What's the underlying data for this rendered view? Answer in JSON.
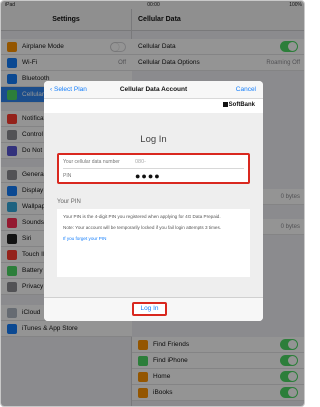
{
  "status_bar": {
    "carrier": "iPad",
    "time": "00:00",
    "battery": "100%"
  },
  "left_pane": {
    "title": "Settings",
    "items": [
      {
        "label": "Airplane Mode",
        "value": ""
      },
      {
        "label": "Wi-Fi",
        "value": "Off"
      },
      {
        "label": "Bluetooth",
        "value": ""
      },
      {
        "label": "Cellular Data",
        "value": ""
      },
      {
        "label": "Notifications",
        "value": ""
      },
      {
        "label": "Control Center",
        "value": ""
      },
      {
        "label": "Do Not Disturb",
        "value": ""
      },
      {
        "label": "General",
        "value": ""
      },
      {
        "label": "Display & Brightness",
        "value": ""
      },
      {
        "label": "Wallpaper",
        "value": ""
      },
      {
        "label": "Sounds",
        "value": ""
      },
      {
        "label": "Siri",
        "value": ""
      },
      {
        "label": "Touch ID & Passcode",
        "value": ""
      },
      {
        "label": "Battery",
        "value": ""
      },
      {
        "label": "Privacy",
        "value": ""
      },
      {
        "label": "iCloud",
        "value": ""
      },
      {
        "label": "iTunes & App Store",
        "value": ""
      }
    ]
  },
  "right_pane": {
    "title": "Cellular Data",
    "items": [
      {
        "label": "Cellular Data",
        "value": ""
      },
      {
        "label": "Cellular Data Options",
        "value": "Roaming Off"
      },
      {
        "label": "0 bytes",
        "value": ""
      },
      {
        "label": "0 bytes",
        "value": ""
      },
      {
        "label": "Find Friends",
        "value": ""
      },
      {
        "label": "Find iPhone",
        "value": ""
      },
      {
        "label": "Home",
        "value": ""
      },
      {
        "label": "iBooks",
        "value": ""
      }
    ]
  },
  "modal": {
    "back_label": "Select Plan",
    "title": "Cellular Data Account",
    "cancel_label": "Cancel",
    "brand": "SoftBank",
    "heading": "Log In",
    "phone_label": "Your cellular data number",
    "phone_value": "080-",
    "pin_label": "PIN",
    "pin_value": "●●●●",
    "pin_section_title": "Your PIN",
    "pin_info": "Your PIN is the 4-digit PIN you registered when applying for 4G Data Prepaid.",
    "lock_note": "Note: Your account will be temporarily locked if you fail login attempts 3 times.",
    "forgot_link": "If you forget your PIN",
    "login_button": "Log In"
  },
  "colors": {
    "accent": "#147efb",
    "highlight": "#d9281f",
    "toggle_on": "#4cd964",
    "selected_row": "#2f86f0"
  }
}
